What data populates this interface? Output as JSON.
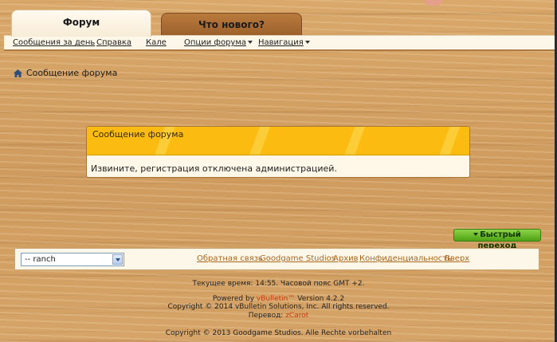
{
  "tabs": {
    "forum": "Форум",
    "whats_new": "Что нового?"
  },
  "menu": {
    "items": [
      "Сообщения за день",
      "Справка",
      "Кале",
      "Опции форума",
      "Навигация"
    ]
  },
  "breadcrumb": {
    "label": "Сообщение форума"
  },
  "message": {
    "title": "Сообщение форума",
    "text": "Извините, регистрация отключена администрацией."
  },
  "quick_nav": {
    "label": "Быстрый переход"
  },
  "footer_bar": {
    "select_value": "-- ranch",
    "links": [
      "Обратная связь",
      "Goodgame Studios",
      "Архив",
      "Конфиденциальность",
      "Вверх"
    ]
  },
  "footer": {
    "time": "Текущее время: 14:55. Часовой пояс GMT +2.",
    "powered_prefix": "Powered by ",
    "powered_brand": "vBulletin™",
    "powered_version": " Version 4.2.2",
    "copyright_vb": "Copyright © 2014 vBulletin Solutions, Inc. All rights reserved.",
    "translation_prefix": "Перевод: ",
    "translation_name": "zCarot",
    "copyright_gg": "Copyright © 2013 Goodgame Studios. Alle Rechte vorbehalten"
  },
  "colors": {
    "accent": "#fbbb10",
    "button_green": "#4ea215",
    "link": "#a9671e"
  }
}
